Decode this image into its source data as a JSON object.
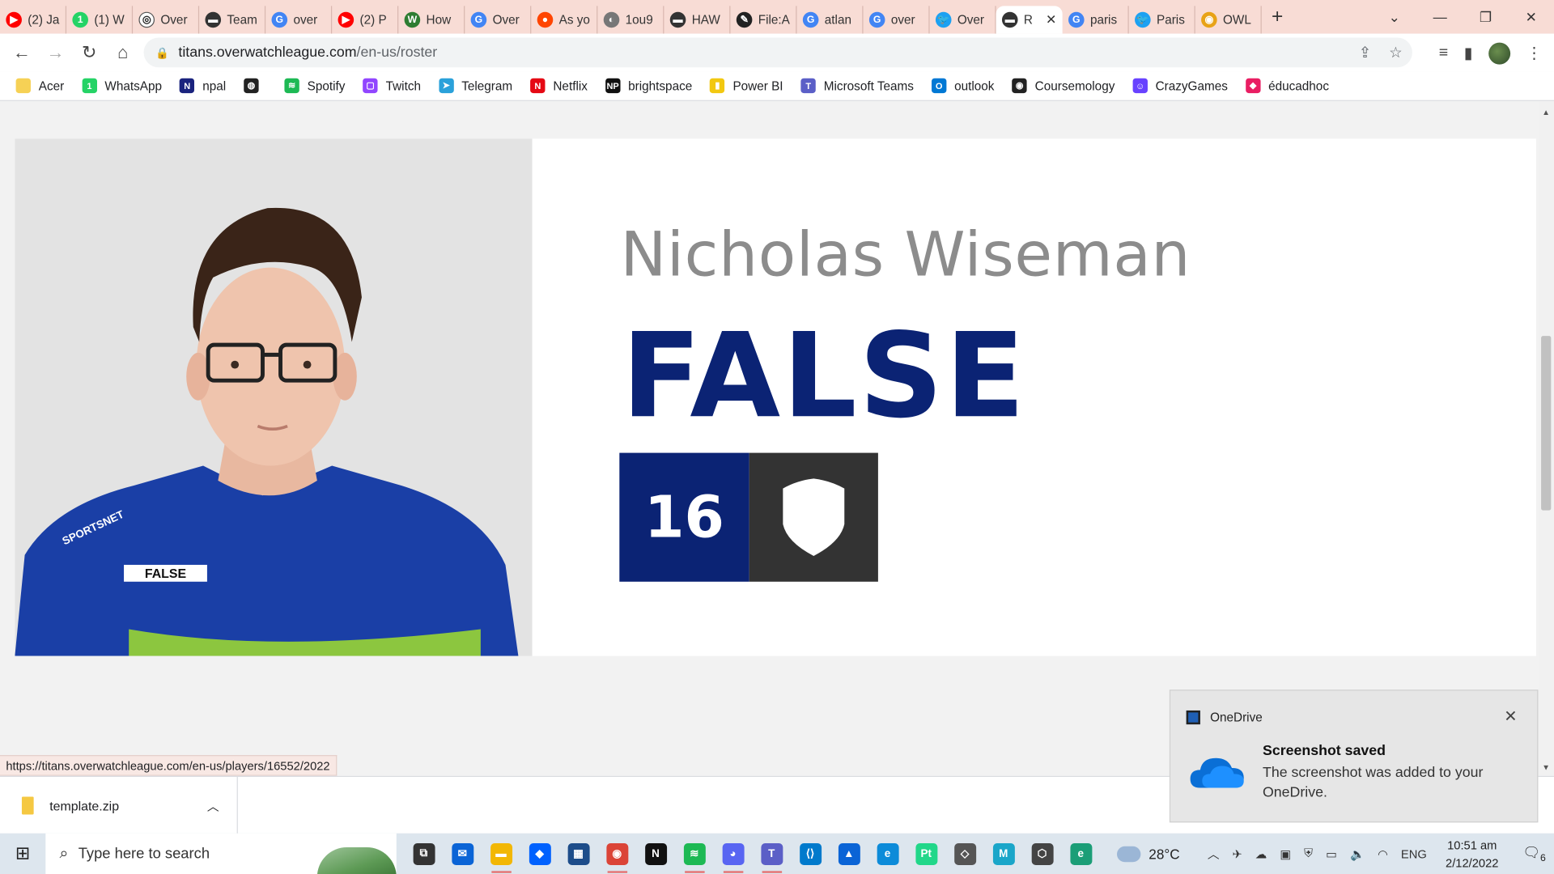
{
  "browser": {
    "tabs": [
      {
        "label": "(2) Ja",
        "color": "#ff0000",
        "glyph": "▶"
      },
      {
        "label": "(1) W",
        "color": "#25d366",
        "glyph": "1"
      },
      {
        "label": "Over",
        "color": "#ffffff",
        "glyph": "◎"
      },
      {
        "label": "Team",
        "color": "#333333",
        "glyph": "▬"
      },
      {
        "label": "over",
        "color": "#4285f4",
        "glyph": "G"
      },
      {
        "label": "(2) P",
        "color": "#ff0000",
        "glyph": "▶"
      },
      {
        "label": "How",
        "color": "#2e7d32",
        "glyph": "W"
      },
      {
        "label": "Over",
        "color": "#4285f4",
        "glyph": "G"
      },
      {
        "label": "As yo",
        "color": "#ff4500",
        "glyph": "●"
      },
      {
        "label": "1ou9",
        "color": "#777777",
        "glyph": "◐"
      },
      {
        "label": "HAW",
        "color": "#333333",
        "glyph": "▬"
      },
      {
        "label": "File:A",
        "color": "#222222",
        "glyph": "✎"
      },
      {
        "label": "atlan",
        "color": "#4285f4",
        "glyph": "G"
      },
      {
        "label": "over",
        "color": "#4285f4",
        "glyph": "G"
      },
      {
        "label": "Over",
        "color": "#1da1f2",
        "glyph": "🐦"
      },
      {
        "label": "R",
        "color": "#333333",
        "glyph": "▬",
        "active": true
      },
      {
        "label": "paris",
        "color": "#4285f4",
        "glyph": "G"
      },
      {
        "label": "Paris",
        "color": "#1da1f2",
        "glyph": "🐦"
      },
      {
        "label": "OWL",
        "color": "#e8a317",
        "glyph": "◉"
      }
    ],
    "url_host": "titans.overwatchleague.com",
    "url_path": "/en-us/roster",
    "bookmarks": [
      {
        "label": "Acer",
        "color": "#f6d155",
        "glyph": ""
      },
      {
        "label": "WhatsApp",
        "color": "#25d366",
        "glyph": "1"
      },
      {
        "label": "npal",
        "color": "#1a237e",
        "glyph": "N"
      },
      {
        "label": "",
        "color": "#222222",
        "glyph": "◍"
      },
      {
        "label": "Spotify",
        "color": "#1db954",
        "glyph": "≋"
      },
      {
        "label": "Twitch",
        "color": "#9146ff",
        "glyph": "▢"
      },
      {
        "label": "Telegram",
        "color": "#2aa1da",
        "glyph": "➤"
      },
      {
        "label": "Netflix",
        "color": "#e50914",
        "glyph": "N"
      },
      {
        "label": "brightspace",
        "color": "#111111",
        "glyph": "NP"
      },
      {
        "label": "Power BI",
        "color": "#f2c811",
        "glyph": "▮"
      },
      {
        "label": "Microsoft Teams",
        "color": "#5b5fc7",
        "glyph": "T"
      },
      {
        "label": "outlook",
        "color": "#0078d4",
        "glyph": "O"
      },
      {
        "label": "Coursemology",
        "color": "#222222",
        "glyph": "◉"
      },
      {
        "label": "CrazyGames",
        "color": "#6842ff",
        "glyph": "☺"
      },
      {
        "label": "éducadhoc",
        "color": "#e91e63",
        "glyph": "◆"
      }
    ],
    "status_url": "https://titans.overwatchleague.com/en-us/players/16552/2022"
  },
  "player": {
    "real_name": "Nicholas Wiseman",
    "handle": "FALSE",
    "number": "16",
    "jersey_label": "FALSE",
    "jersey_sponsor": "SPORTSNET",
    "role_icon": "shield-role-icon"
  },
  "downloads": {
    "file": "template.zip"
  },
  "toast": {
    "app": "OneDrive",
    "title": "Screenshot saved",
    "body": "The screenshot was added to your OneDrive."
  },
  "taskbar": {
    "search_placeholder": "Type here to search",
    "temperature": "28°C",
    "language": "ENG",
    "time": "10:51 am",
    "date": "2/12/2022",
    "notification_count": "6"
  },
  "colors": {
    "brand_navy": "#0b2374",
    "name_gray": "#8c8c8c",
    "role_bg": "#333333"
  }
}
